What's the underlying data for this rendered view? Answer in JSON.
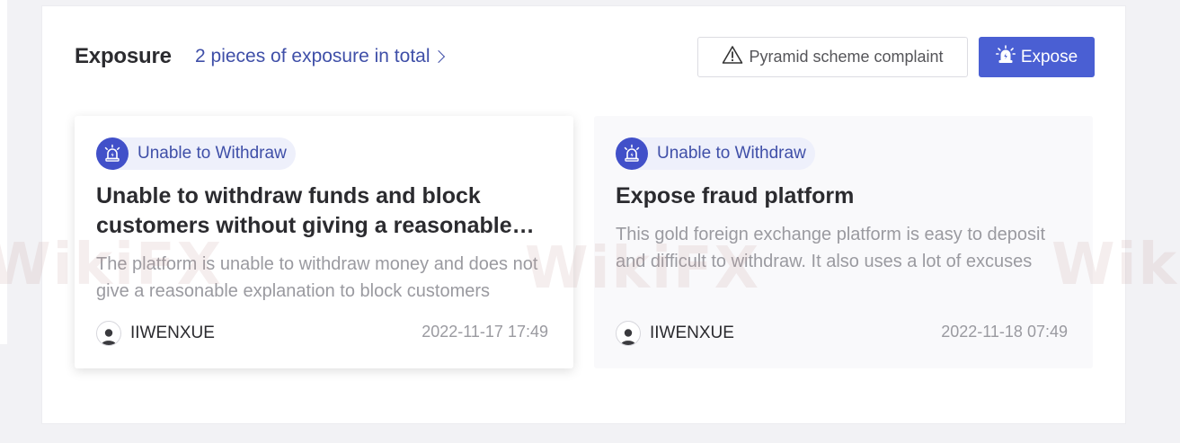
{
  "section": {
    "title": "Exposure",
    "total_link": "2 pieces of exposure in total"
  },
  "actions": {
    "complaint_label": "Pyramid scheme complaint",
    "expose_label": "Expose"
  },
  "cards": [
    {
      "tag": "Unable to Withdraw",
      "title": "Unable to withdraw funds and block customers without giving a reasonable explanation",
      "description": "The platform is unable to withdraw money and does not give a reasonable explanation to block customers",
      "author": "IIWENXUE",
      "date": "2022-11-17 17:49"
    },
    {
      "tag": "Unable to Withdraw",
      "title": "Expose fraud platform",
      "description": "This gold foreign exchange platform is easy to deposit and difficult to withdraw. It also uses a lot of excuses",
      "author": "IIWENXUE",
      "date": "2022-11-18 07:49"
    }
  ],
  "watermark": "WikiFX",
  "colors": {
    "accent": "#4a5fd3",
    "link": "#3f4fa8",
    "tag_bg": "#eef0fb"
  }
}
